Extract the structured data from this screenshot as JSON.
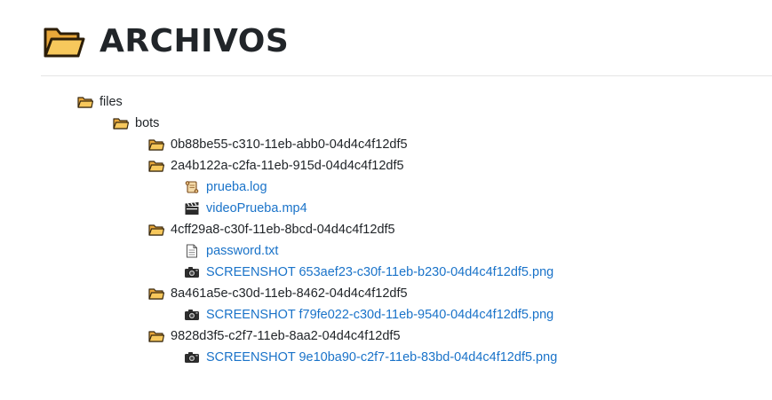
{
  "header": {
    "title": "ARCHIVOS",
    "icon": "open-folder-icon"
  },
  "tree": {
    "root": {
      "label": "files",
      "icon": "folder-icon"
    },
    "bots": {
      "label": "bots",
      "icon": "folder-icon"
    },
    "folders": [
      {
        "label": "0b88be55-c310-11eb-abb0-04d4c4f12df5",
        "icon": "folder-icon",
        "files": []
      },
      {
        "label": "2a4b122a-c2fa-11eb-915d-04d4c4f12df5",
        "icon": "folder-icon",
        "files": [
          {
            "label": "prueba.log",
            "icon": "scroll-icon"
          },
          {
            "label": "videoPrueba.mp4",
            "icon": "clapperboard-icon"
          }
        ]
      },
      {
        "label": "4cff29a8-c30f-11eb-8bcd-04d4c4f12df5",
        "icon": "folder-icon",
        "files": [
          {
            "label": "password.txt",
            "icon": "document-icon"
          },
          {
            "label": "SCREENSHOT 653aef23-c30f-11eb-b230-04d4c4f12df5.png",
            "icon": "camera-icon"
          }
        ]
      },
      {
        "label": "8a461a5e-c30d-11eb-8462-04d4c4f12df5",
        "icon": "folder-icon",
        "files": [
          {
            "label": "SCREENSHOT f79fe022-c30d-11eb-9540-04d4c4f12df5.png",
            "icon": "camera-icon"
          }
        ]
      },
      {
        "label": "9828d3f5-c2f7-11eb-8aa2-04d4c4f12df5",
        "icon": "folder-icon",
        "files": [
          {
            "label": "SCREENSHOT 9e10ba90-c2f7-11eb-83bd-04d4c4f12df5.png",
            "icon": "camera-icon"
          }
        ]
      }
    ]
  },
  "colors": {
    "link": "#1a73c9",
    "text": "#212529",
    "folder_fill": "#f6c75a",
    "folder_stroke": "#3a2a10"
  }
}
